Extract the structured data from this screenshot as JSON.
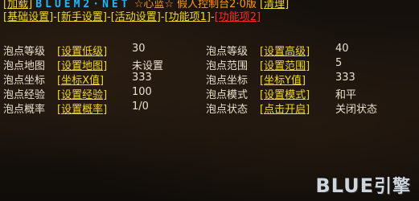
{
  "top": {
    "add_btn": "[加载]",
    "site": "BLUEM2·NET",
    "heart": "☆心蓝☆",
    "fake_console": "假人控制台2·0版",
    "clean_btn": "[清理]"
  },
  "tabs": {
    "items": [
      "[基础设置]",
      "-",
      "[新手设置]",
      "-",
      "[活动设置]",
      "-",
      "[功能项1]",
      "-",
      "[功能项2]"
    ]
  },
  "settings": {
    "left": [
      {
        "label": "泡点等级",
        "btn": "[设置低级]",
        "value": "30"
      },
      {
        "label": "泡点地图",
        "btn": "[设置地图]",
        "value": "未设置"
      },
      {
        "label": "泡点坐标",
        "btn": "[坐标X值]",
        "value": "333"
      },
      {
        "label": "泡点经验",
        "btn": "[设置经验]",
        "value": "100"
      },
      {
        "label": "泡点概率",
        "btn": "[设置概率]",
        "value": "1/0"
      }
    ],
    "right": [
      {
        "label": "泡点等级",
        "btn": "[设置高级]",
        "value": "40"
      },
      {
        "label": "泡点范围",
        "btn": "[设置范围]",
        "value": "5"
      },
      {
        "label": "泡点坐标",
        "btn": "[坐标Y值]",
        "value": "333"
      },
      {
        "label": "泡点模式",
        "btn": "[设置模式]",
        "value": "和平"
      },
      {
        "label": "泡点状态",
        "btn": "[点击开启]",
        "value": "关闭状态"
      }
    ]
  },
  "logo": {
    "text": "BLUE",
    "cn": "引擎"
  },
  "colors": {
    "link": "#f1d72a",
    "alert": "#ff2a2a",
    "title": "#21b8ff",
    "accent": "#ff9a18"
  }
}
